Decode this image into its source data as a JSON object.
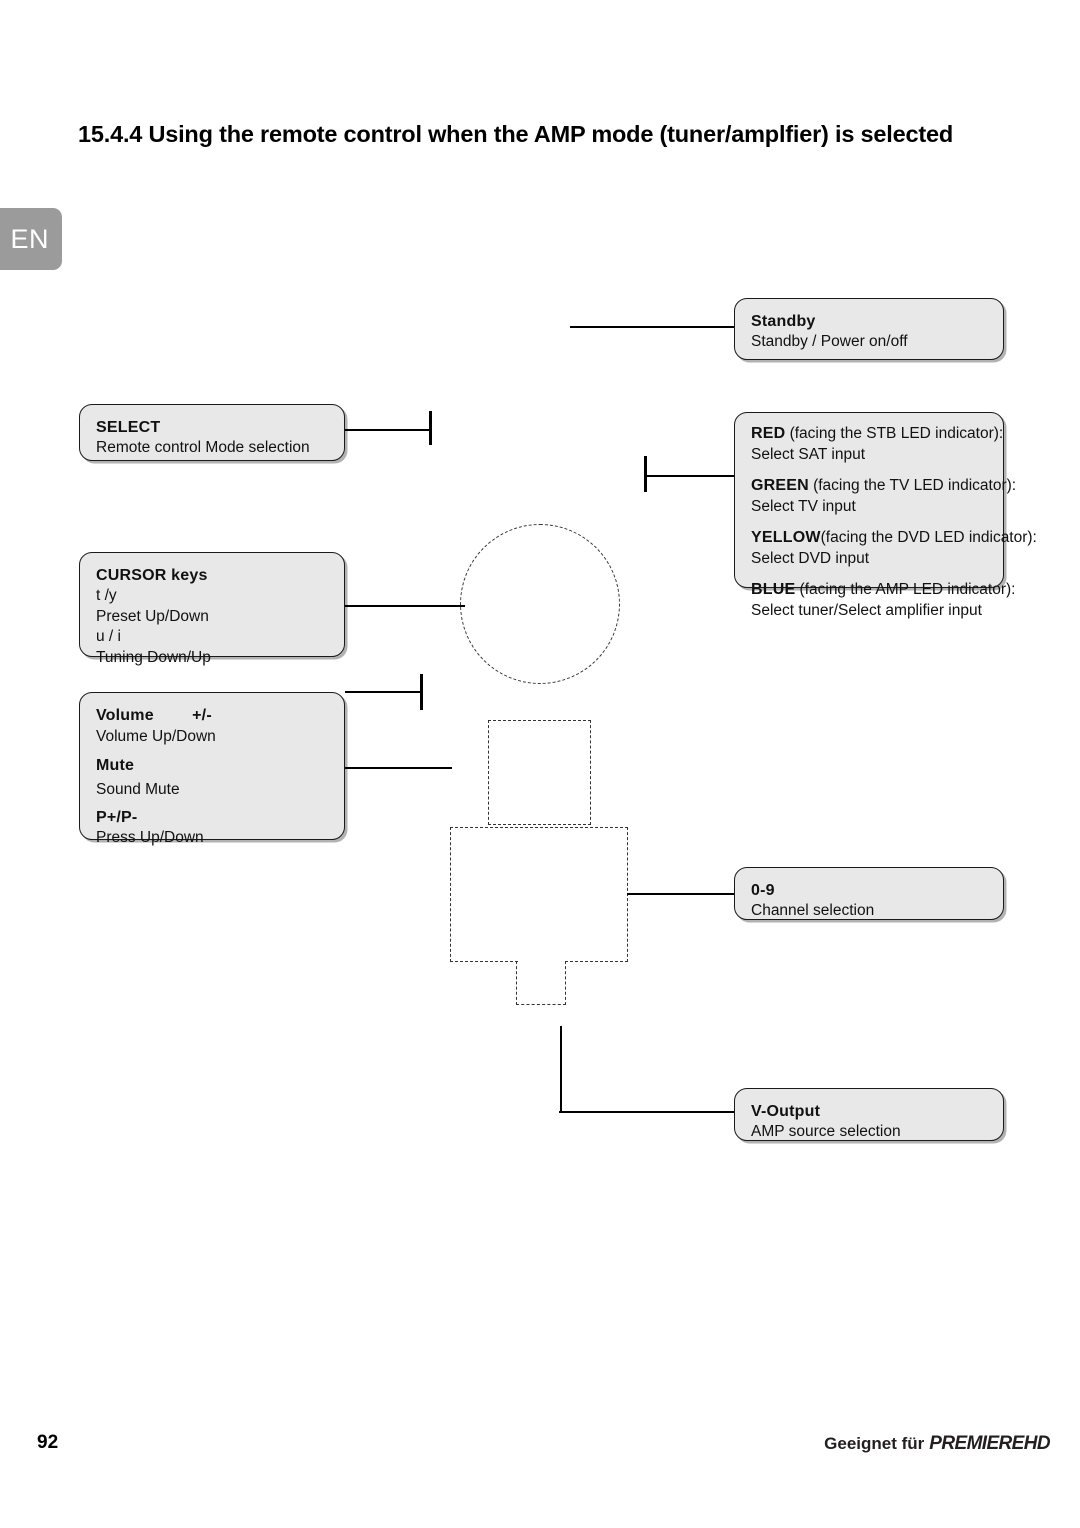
{
  "page": {
    "language_tab": "EN",
    "number": "92",
    "title": "15.4.4 Using the remote control when the AMP mode (tuner/amplfier) is selected"
  },
  "footer": {
    "prefix": "Geeignet für",
    "brand": "PREMIERE",
    "brand_suffix": "HD"
  },
  "callouts": {
    "standby": {
      "heading": "Standby",
      "description": "Standby / Power on/off"
    },
    "select": {
      "heading": "SELECT",
      "description": "Remote control Mode selection"
    },
    "cursor": {
      "heading": "CURSOR keys",
      "line1_keys": "t  /y",
      "line1_desc": "Preset Up/Down",
      "line2_keys": "u  /  i",
      "line2_desc": "Tuning Down/Up"
    },
    "volume": {
      "heading": "Volume",
      "heading_suffix": "+/-",
      "description": "Volume Up/Down",
      "mute_heading": "Mute",
      "mute_description": "Sound Mute",
      "preset_heading": "P+/P-",
      "preset_description": "Press Up/Down"
    },
    "colour_buttons": {
      "red_label": "RED",
      "red_context": "(facing the STB LED indicator):",
      "red_action": "Select SAT input",
      "green_label": "GREEN",
      "green_context": "(facing the TV LED indicator):",
      "green_action": "Select TV input",
      "yellow_label": "YELLOW",
      "yellow_context": "(facing the DVD LED indicator):",
      "yellow_action": "Select DVD input",
      "blue_label": "BLUE",
      "blue_context": "(facing the AMP LED indicator):",
      "blue_action": "Select tuner/Select amplifier input"
    },
    "numeric": {
      "heading": "0-9",
      "description": "Channel selection"
    },
    "voutput": {
      "heading": "V-Output",
      "description": "AMP source selection"
    }
  }
}
